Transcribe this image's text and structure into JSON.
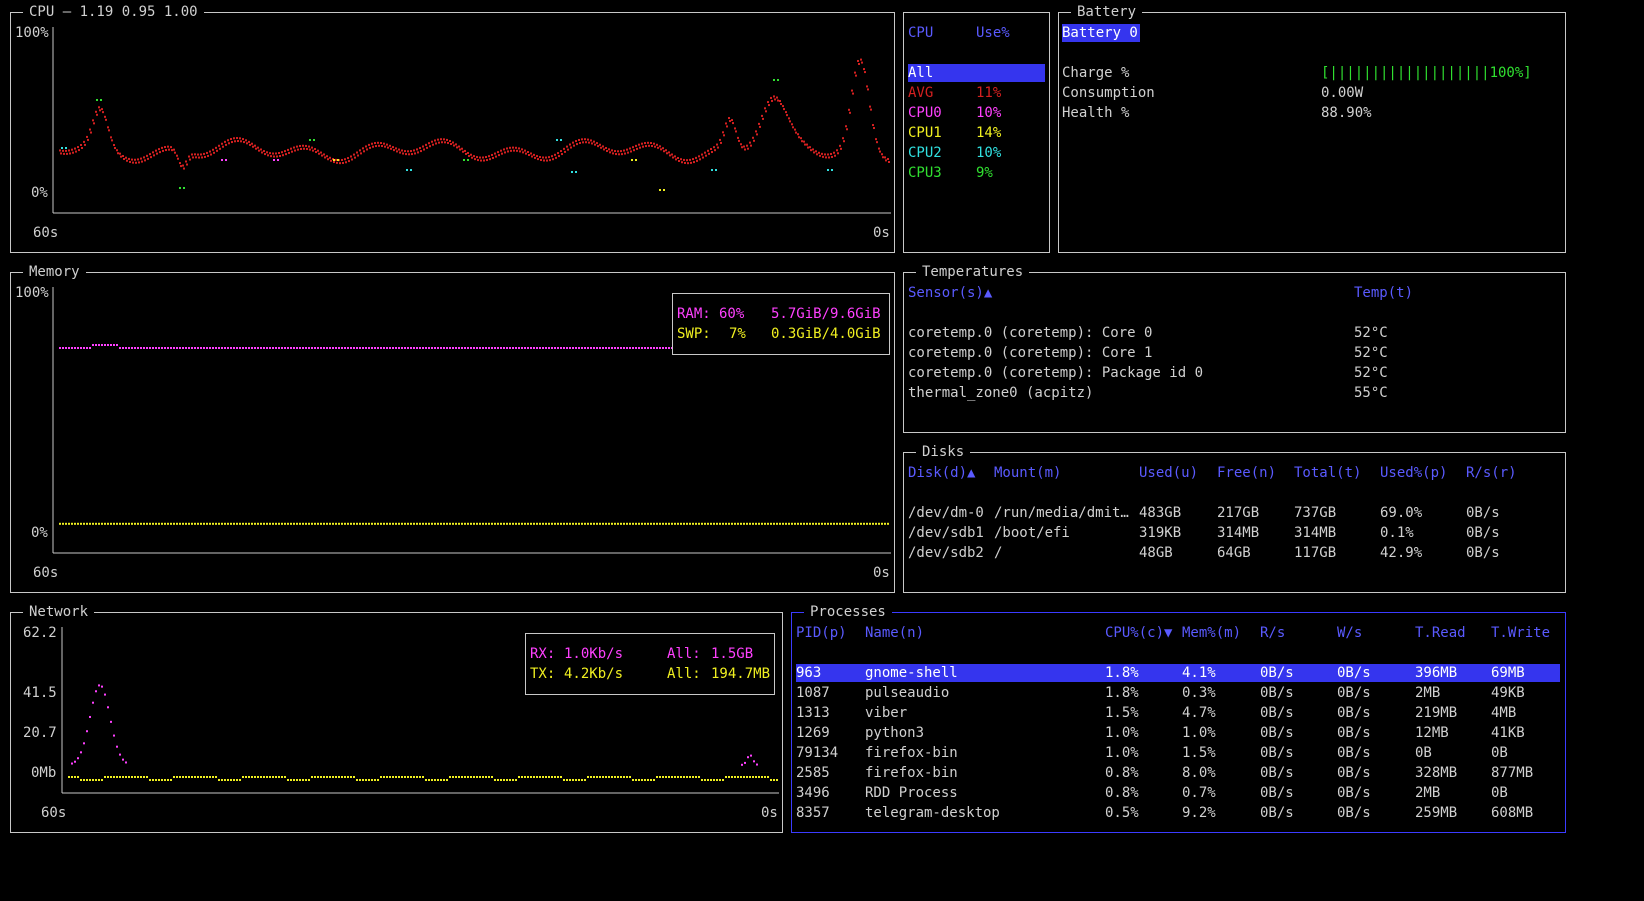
{
  "colors": {
    "red": "#d42020",
    "magenta": "#ff40ff",
    "yellow": "#f0f020",
    "cyan": "#30e0e0",
    "green": "#30e030",
    "blue": "#5a5aff",
    "sel_bg": "#3535ee"
  },
  "cpu": {
    "title": "CPU — 1.19 0.95 1.00",
    "y_top": "100%",
    "y_bottom": "0%",
    "x_left": "60s",
    "x_right": "0s",
    "table_header": {
      "cpu": "CPU",
      "use": "Use%"
    },
    "rows": [
      {
        "name": "All",
        "use": ""
      },
      {
        "name": "AVG",
        "use": "11%"
      },
      {
        "name": "CPU0",
        "use": "10%"
      },
      {
        "name": "CPU1",
        "use": "14%"
      },
      {
        "name": "CPU2",
        "use": "10%"
      },
      {
        "name": "CPU3",
        "use": "9%"
      }
    ]
  },
  "battery": {
    "title": "Battery",
    "tab": "Battery 0",
    "rows": [
      {
        "label": "Charge %",
        "value": "[|||||||||||||||||||100%]"
      },
      {
        "label": "Consumption",
        "value": "0.00W"
      },
      {
        "label": "Health %",
        "value": "88.90%"
      }
    ]
  },
  "memory": {
    "title": "Memory",
    "y_top": "100%",
    "y_bottom": "0%",
    "x_left": "60s",
    "x_right": "0s",
    "ram": {
      "label": "RAM:",
      "pct": "60%",
      "amount": "5.7GiB/9.6GiB",
      "fraction": 0.6
    },
    "swp": {
      "label": "SWP:",
      "pct": "7%",
      "amount": "0.3GiB/4.0GiB",
      "fraction": 0.07
    }
  },
  "temperatures": {
    "title": "Temperatures",
    "header": {
      "sensor": "Sensor(s)▲",
      "temp": "Temp(t)"
    },
    "rows": [
      {
        "sensor": "coretemp.0 (coretemp): Core 0",
        "temp": "52°C"
      },
      {
        "sensor": "coretemp.0 (coretemp): Core 1",
        "temp": "52°C"
      },
      {
        "sensor": "coretemp.0 (coretemp): Package id 0",
        "temp": "52°C"
      },
      {
        "sensor": "thermal_zone0 (acpitz)",
        "temp": "55°C"
      }
    ]
  },
  "disks": {
    "title": "Disks",
    "header": [
      "Disk(d)▲",
      "Mount(m)",
      "Used(u)",
      "Free(n)",
      "Total(t)",
      "Used%(p)",
      "R/s(r)"
    ],
    "rows": [
      [
        "/dev/dm-0",
        "/run/media/dmit…",
        "483GB",
        "217GB",
        "737GB",
        "69.0%",
        "0B/s"
      ],
      [
        "/dev/sdb1",
        "/boot/efi",
        "319KB",
        "314MB",
        "314MB",
        "0.1%",
        "0B/s"
      ],
      [
        "/dev/sdb2",
        "/",
        "48GB",
        "64GB",
        "117GB",
        "42.9%",
        "0B/s"
      ]
    ]
  },
  "network": {
    "title": "Network",
    "y_ticks": [
      "62.2",
      "41.5",
      "20.7",
      "0Mb"
    ],
    "x_left": "60s",
    "x_right": "0s",
    "rx": {
      "label": "RX:",
      "rate": "1.0Kb/s",
      "all_label": "All:",
      "all": "1.5GB"
    },
    "tx": {
      "label": "TX:",
      "rate": "4.2Kb/s",
      "all_label": "All:",
      "all": "194.7MB"
    }
  },
  "processes": {
    "title": "Processes",
    "header": [
      "PID(p)",
      "Name(n)",
      "CPU%(c)▼",
      "Mem%(m)",
      "R/s",
      "W/s",
      "T.Read",
      "T.Write"
    ],
    "rows": [
      [
        "963",
        "gnome-shell",
        "1.8%",
        "4.1%",
        "0B/s",
        "0B/s",
        "396MB",
        "69MB"
      ],
      [
        "1087",
        "pulseaudio",
        "1.8%",
        "0.3%",
        "0B/s",
        "0B/s",
        "2MB",
        "49KB"
      ],
      [
        "1313",
        "viber",
        "1.5%",
        "4.7%",
        "0B/s",
        "0B/s",
        "219MB",
        "4MB"
      ],
      [
        "1269",
        "python3",
        "1.0%",
        "1.0%",
        "0B/s",
        "0B/s",
        "12MB",
        "41KB"
      ],
      [
        "79134",
        "firefox-bin",
        "1.0%",
        "1.5%",
        "0B/s",
        "0B/s",
        "0B",
        "0B"
      ],
      [
        "2585",
        "firefox-bin",
        "0.8%",
        "8.0%",
        "0B/s",
        "0B/s",
        "328MB",
        "877MB"
      ],
      [
        "3496",
        "RDD Process",
        "0.8%",
        "0.7%",
        "0B/s",
        "0B/s",
        "2MB",
        "0B"
      ],
      [
        "8357",
        "telegram-desktop",
        "0.5%",
        "9.2%",
        "0B/s",
        "0B/s",
        "259MB",
        "608MB"
      ]
    ]
  }
}
